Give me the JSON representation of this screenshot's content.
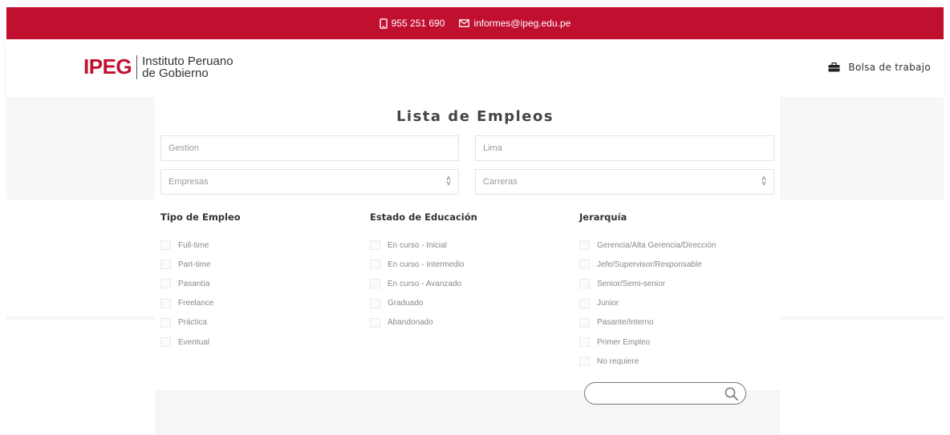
{
  "topbar": {
    "phone": "955 251 690",
    "email": "informes@ipeg.edu.pe",
    "color": "#c10f30"
  },
  "header": {
    "logo_short": "IPEG",
    "logo_line1": "Instituto Peruano",
    "logo_line2": "de Gobierno",
    "jobs_link": "Bolsa de trabajo"
  },
  "page": {
    "title": "Lista de Empleos"
  },
  "filters": {
    "keyword_placeholder": "Gestion",
    "location_placeholder": "Lima",
    "company_select": "Empresas",
    "career_select": "Carreras"
  },
  "groups": {
    "tipo": {
      "title": "Tipo de Empleo",
      "options": [
        "Full-time",
        "Part-time",
        "Pasantía",
        "Freelance",
        "Práctica",
        "Eventual"
      ]
    },
    "educacion": {
      "title": "Estado de Educación",
      "options": [
        "En curso - Inicial",
        "En curso - Intermedio",
        "En curso - Avanzado",
        "Graduado",
        "Abandonado"
      ]
    },
    "jerarquia": {
      "title": "Jerarquía",
      "options": [
        "Gerencia/Alta Gerencia/Dirección",
        "Jefe/Supervisor/Responsable",
        "Senior/Semi-senior",
        "Junior",
        "Pasante/Interno",
        "Primer Empleo",
        "No requiere"
      ]
    }
  },
  "icons": {
    "phone": "phone-icon",
    "email": "envelope-icon",
    "jobs": "briefcase-icon",
    "search": "search-icon",
    "select": "updown-arrows-icon"
  }
}
